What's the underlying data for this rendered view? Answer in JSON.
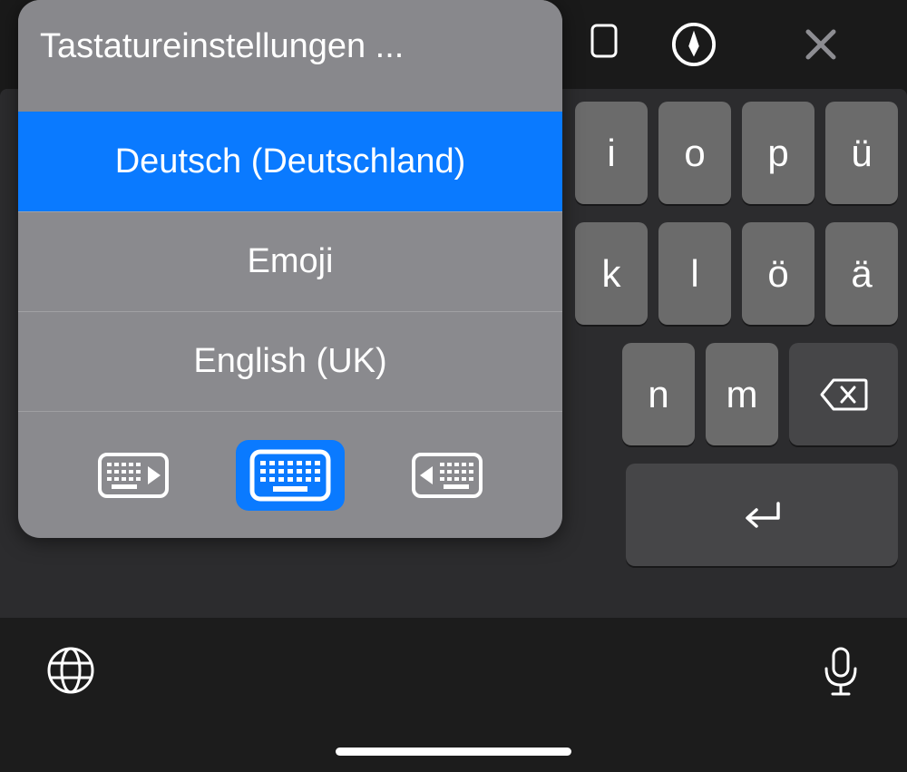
{
  "toolbar": {
    "pen_icon": "pen-circle",
    "close_icon": "x"
  },
  "popup": {
    "title": "Tastatureinstellungen ...",
    "items": [
      {
        "label": "Deutsch (Deutschland)",
        "selected": true
      },
      {
        "label": "Emoji",
        "selected": false
      },
      {
        "label": "English (UK)",
        "selected": false
      }
    ],
    "dock": {
      "left": "dock-left",
      "center": "dock-center",
      "right": "dock-right",
      "selected": "center"
    }
  },
  "keys": {
    "row1": [
      "i",
      "o",
      "p",
      "ü"
    ],
    "row2": [
      "k",
      "l",
      "ö",
      "ä"
    ],
    "row3": [
      "n",
      "m"
    ],
    "backspace": "⌫",
    "enter": "↵"
  },
  "bottom": {
    "globe": "globe",
    "mic": "microphone"
  },
  "colors": {
    "accent": "#0a7aff",
    "key": "#6b6b6b",
    "func_key": "#464648",
    "popup_bg": "#8a8a8e"
  }
}
